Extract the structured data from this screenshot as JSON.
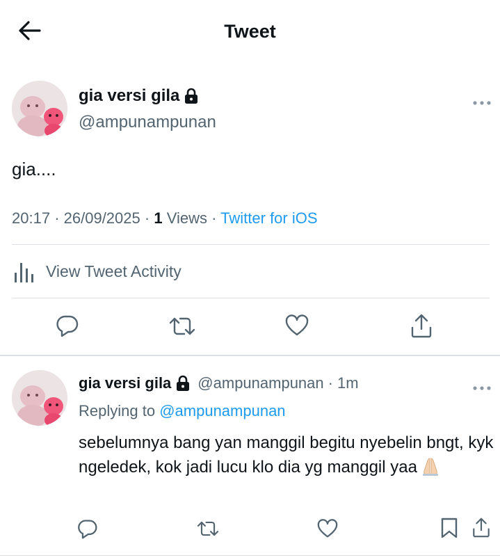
{
  "header": {
    "title": "Tweet"
  },
  "tweet": {
    "author_name": "gia versi gila",
    "author_handle": "@ampunampunan",
    "text": "gia....",
    "time": "20:17",
    "date": "26/09/2025",
    "views_count": "1",
    "views_label": "Views",
    "source": "Twitter for iOS"
  },
  "activity": {
    "label": "View Tweet Activity"
  },
  "reply": {
    "author_name": "gia versi gila",
    "author_handle": "@ampunampunan",
    "age": "1m",
    "replying_prefix": "Replying to",
    "replying_to": "@ampunampunan",
    "text": "sebelumnya bang yan manggil begitu nyebelin bngt, kyk ngeledek, kok jadi lucu klo dia yg manggil yaa"
  },
  "icons": {
    "back": "arrow-left-icon",
    "lock": "lock-icon",
    "more": "more-dots-icon",
    "activity": "bar-chart-icon",
    "reply": "comment-icon",
    "retweet": "retweet-icon",
    "like": "heart-icon",
    "share": "share-icon",
    "bookmark": "bookmark-icon",
    "emoji": "folded-hands-emoji"
  },
  "colors": {
    "accent": "#1d9bf0",
    "secondary_text": "#536471",
    "divider": "#dcdfe3"
  }
}
